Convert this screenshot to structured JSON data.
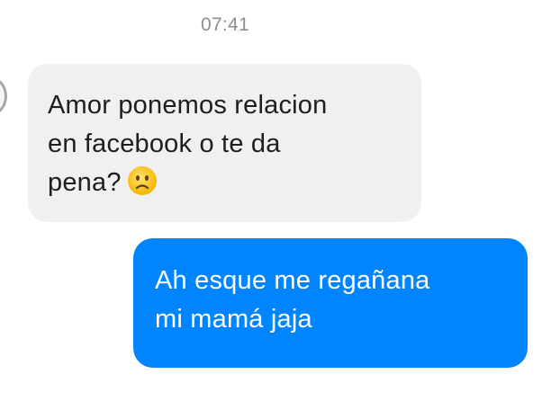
{
  "timestamp": "07:41",
  "messages": [
    {
      "direction": "incoming",
      "lines": [
        "Amor ponemos relacion",
        "en facebook o te da",
        "pena?"
      ],
      "emoji": "slightly-frowning-face-icon"
    },
    {
      "direction": "outgoing",
      "lines": [
        "Ah esque me regañana",
        "mi mamá jaja"
      ]
    }
  ],
  "colors": {
    "incoming_bubble": "#f1f0f0",
    "outgoing_bubble": "#0084ff",
    "timestamp_text": "#8e8e93"
  }
}
